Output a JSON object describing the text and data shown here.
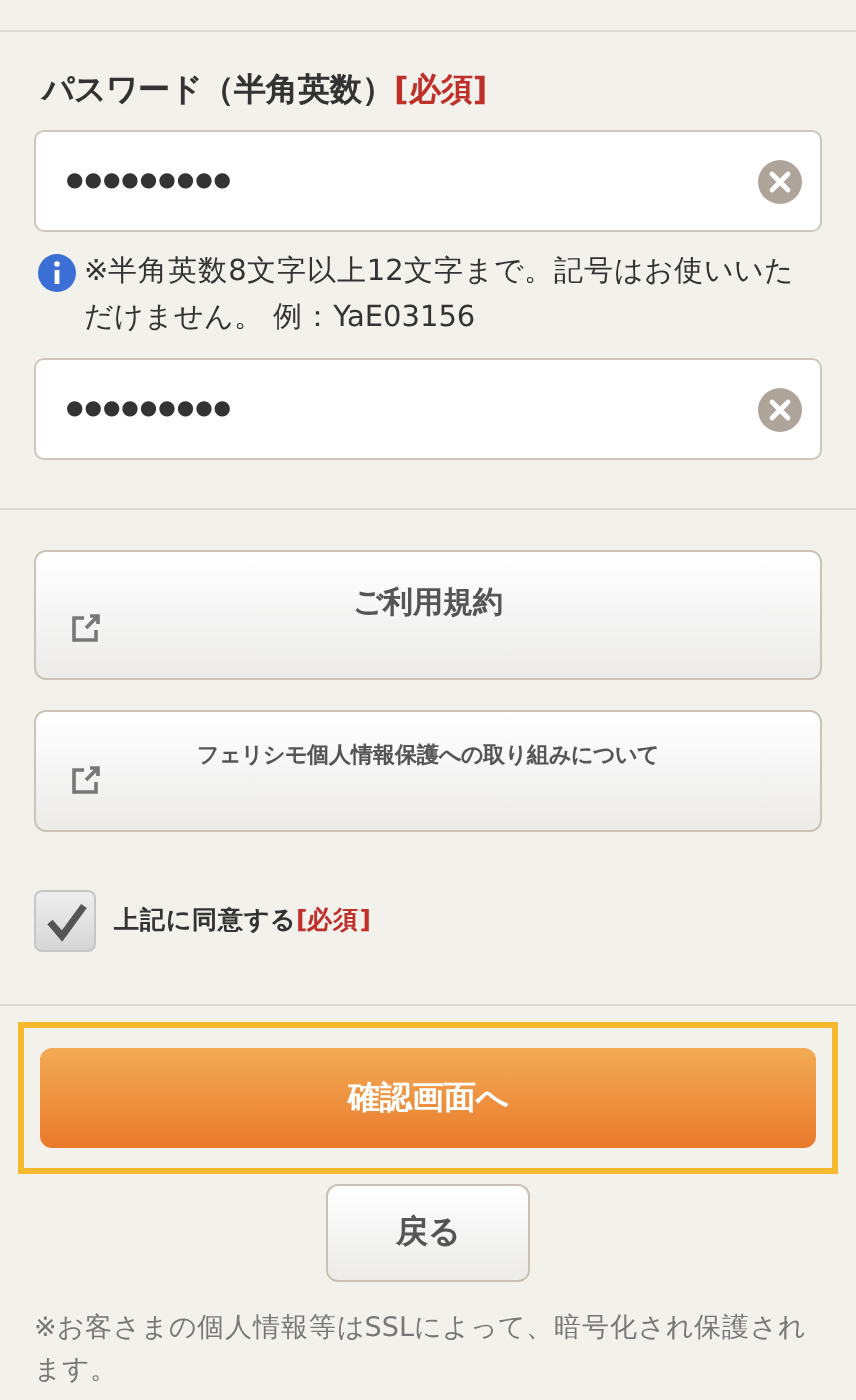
{
  "password": {
    "label": "パスワード（半角英数）",
    "required": "[必須]",
    "value": "●●●●●●●●●",
    "hint": "※半角英数8文字以上12文字まで。記号はお使いいただけません。 例：YaE03156",
    "confirm_value": "●●●●●●●●●"
  },
  "links": [
    {
      "label": "ご利用規約",
      "kind": "large"
    },
    {
      "label": "フェリシモ個人情報保護への取り組みについて",
      "kind": "small"
    }
  ],
  "agree": {
    "label": "上記に同意する",
    "required": "[必須]",
    "checked": true
  },
  "confirm_button": {
    "label": "確認画面へ",
    "focused": true
  },
  "back_button": {
    "label": "戻る"
  },
  "note": "※お客さまの個人情報等はSSLによって、暗号化され保護されます。"
}
